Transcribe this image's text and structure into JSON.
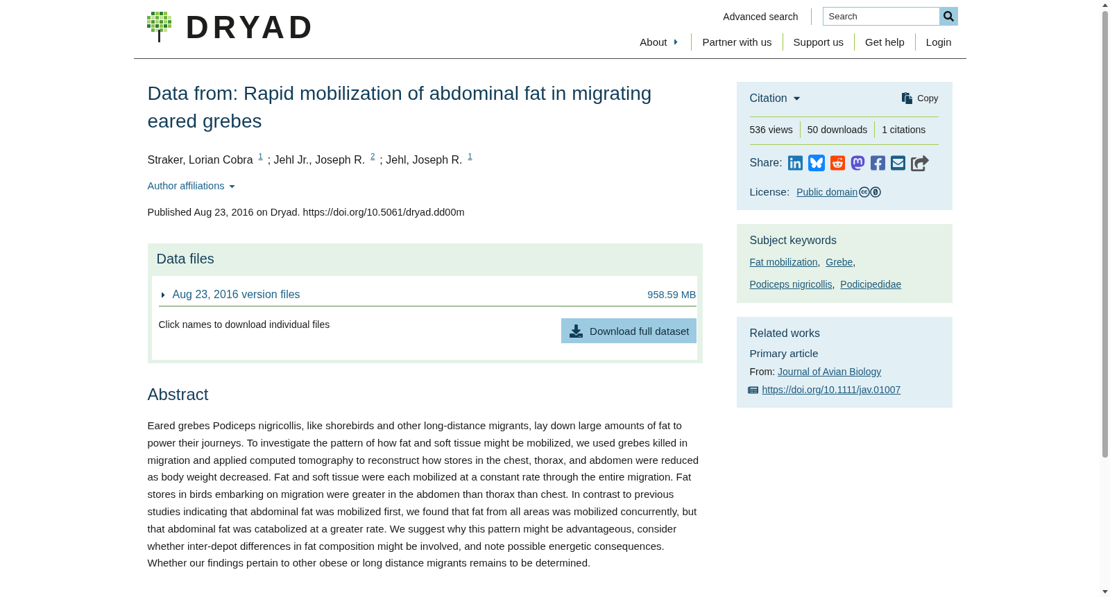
{
  "header": {
    "logo": {
      "text": "DRYAD"
    },
    "advanced_search": "Advanced search",
    "search": {
      "placeholder": "Search"
    },
    "nav": [
      {
        "label": "About",
        "kind": "menu"
      },
      {
        "label": "Partner with us",
        "kind": "link"
      },
      {
        "label": "Support us",
        "kind": "link"
      },
      {
        "label": "Get help",
        "kind": "link"
      },
      {
        "label": "Login",
        "kind": "link"
      }
    ]
  },
  "dataset": {
    "title": "Data from: Rapid mobilization of abdominal fat in migrating eared grebes",
    "authors": [
      {
        "name": "Straker, Lorian Cobra",
        "affiliation": "1"
      },
      {
        "name": "; Jehl Jr., Joseph R.",
        "affiliation": "2"
      },
      {
        "name": "; Jehl, Joseph R.",
        "affiliation": "1"
      }
    ],
    "affiliations_toggle": {
      "label": "Author affiliations",
      "expanded": false
    },
    "published": "Published Aug 23, 2016 on Dryad. https://doi.org/10.5061/dryad.dd00m"
  },
  "data_files": {
    "title": "Data files",
    "versions": [
      {
        "label": "Aug 23, 2016 version files",
        "size": "958.59 MB",
        "expanded": false
      }
    ],
    "hint": "Click names to download individual files",
    "download_button": "Download full dataset"
  },
  "abstract": {
    "title": "Abstract",
    "text": "Eared grebes Podiceps nigricollis, like shorebirds and other long-distance migrants, lay down large amounts of fat to power their journeys. To investigate the pattern of how fat and soft tissue might be mobilized, we used grebes killed in migration and applied computed tomography to reconstruct how stores in the chest, thorax, and abdomen were reduced as body weight decreased. Fat and soft tissue were each mobilized at a constant rate through the entire migration. Fat stores in birds embarking on migration were greater in the abdomen than thorax than chest. In contrast to previous studies indicating that abdominal fat was mobilized first, we found that fat from all areas was mobilized concurrently, but that abdominal fat was catabolized at a greater rate. We suggest why this pattern might be advantageous, consider whether inter-depot differences in fat composition might be involved, and note possible energetic consequences. Whether our findings pertain to other obese or long distance migrants remains to be determined."
  },
  "sidebar": {
    "citation": {
      "label": "Citation",
      "expanded": false,
      "copy_button": "Copy"
    },
    "metrics": [
      "536 views",
      "50 downloads",
      "1 citations"
    ],
    "share": {
      "label": "Share:"
    },
    "license": {
      "label": "License:",
      "value": "Public domain"
    },
    "keywords": {
      "title": "Subject keywords",
      "items": [
        {
          "label": "Fat mobilization",
          "separator": ","
        },
        {
          "label": "Grebe",
          "separator": ","
        },
        {
          "label": "Podiceps nigricollis",
          "separator": ","
        },
        {
          "label": "Podicipedidae"
        }
      ]
    },
    "related_works": {
      "title": "Related works",
      "items": [
        {
          "type": "Primary article",
          "source_label": "From:",
          "source": "Journal of Avian Biology",
          "doi": "https://doi.org/10.1111/jav.01007"
        }
      ]
    }
  }
}
